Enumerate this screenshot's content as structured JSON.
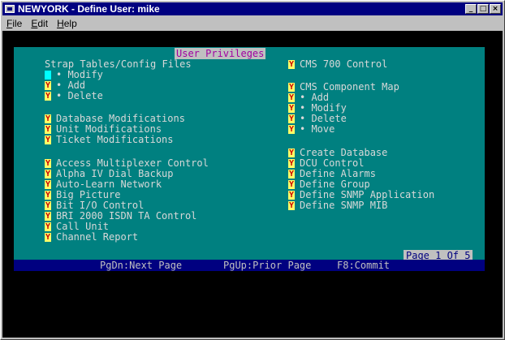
{
  "window": {
    "title": "NEWYORK - Define User: mike",
    "buttons": [
      "minimize",
      "maximize",
      "close"
    ]
  },
  "menu": [
    {
      "label": "File",
      "accel": "F"
    },
    {
      "label": "Edit",
      "accel": "E"
    },
    {
      "label": "Help",
      "accel": "H"
    }
  ],
  "panel": {
    "title": "User Privileges",
    "left": {
      "strap_header": "Strap Tables/Config Files",
      "strap_items": [
        "• Modify",
        "• Add",
        "• Delete"
      ],
      "mods": [
        "Database Modifications",
        "Unit Modifications",
        "Ticket Modifications"
      ],
      "controls": [
        "Access Multiplexer Control",
        "Alpha IV Dial Backup",
        "Auto-Learn Network",
        "Big Picture",
        "Bit I/O Control",
        "BRI 2000 ISDN TA Control",
        "Call Unit",
        "Channel Report"
      ]
    },
    "right": {
      "cms700": "CMS 700 Control",
      "component_map": "CMS Component Map",
      "component_items": [
        "• Add",
        "• Modify",
        "• Delete",
        "• Move"
      ],
      "db_items": [
        "Create Database",
        "DCU Control",
        "Define Alarms",
        "Define Group",
        "Define SNMP Application",
        "Define SNMP MIB"
      ]
    },
    "check_glyph": "Y",
    "page_indicator": "Page 1 Of 5"
  },
  "status": {
    "pgdn": "PgDn:Next Page",
    "pgup": "PgUp:Prior Page",
    "f8": "F8:Commit"
  },
  "colors": {
    "titlebar": "#000080",
    "panel": "#008080",
    "checkbox": "#ffff66",
    "cursor": "#00ffff",
    "status": "#000080"
  }
}
